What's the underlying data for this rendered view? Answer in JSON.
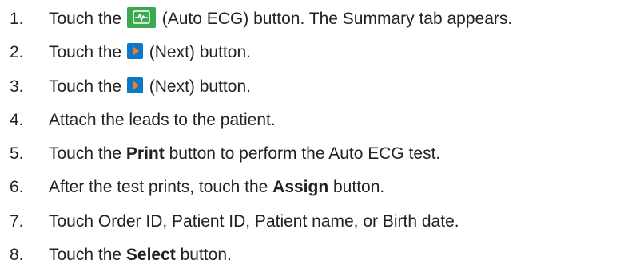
{
  "steps": [
    {
      "number": "1.",
      "parts": [
        {
          "type": "text",
          "value": "Touch the "
        },
        {
          "type": "icon",
          "icon": "auto-ecg-icon"
        },
        {
          "type": "text",
          "value": " (Auto ECG) button. The Summary tab appears."
        }
      ]
    },
    {
      "number": "2.",
      "parts": [
        {
          "type": "text",
          "value": "Touch the "
        },
        {
          "type": "icon",
          "icon": "next-icon"
        },
        {
          "type": "text",
          "value": " (Next) button."
        }
      ]
    },
    {
      "number": "3.",
      "parts": [
        {
          "type": "text",
          "value": "Touch the "
        },
        {
          "type": "icon",
          "icon": "next-icon"
        },
        {
          "type": "text",
          "value": " (Next) button."
        }
      ]
    },
    {
      "number": "4.",
      "parts": [
        {
          "type": "text",
          "value": "Attach the leads to the patient."
        }
      ]
    },
    {
      "number": "5.",
      "parts": [
        {
          "type": "text",
          "value": "Touch the "
        },
        {
          "type": "bold",
          "value": "Print"
        },
        {
          "type": "text",
          "value": " button to perform the Auto ECG test."
        }
      ]
    },
    {
      "number": "6.",
      "parts": [
        {
          "type": "text",
          "value": "After the test prints, touch the "
        },
        {
          "type": "bold",
          "value": "Assign"
        },
        {
          "type": "text",
          "value": " button."
        }
      ]
    },
    {
      "number": "7.",
      "parts": [
        {
          "type": "text",
          "value": "Touch Order ID, Patient ID, Patient name, or Birth date."
        }
      ]
    },
    {
      "number": "8.",
      "parts": [
        {
          "type": "text",
          "value": "Touch the "
        },
        {
          "type": "bold",
          "value": "Select"
        },
        {
          "type": "text",
          "value": " button."
        }
      ]
    }
  ],
  "colors": {
    "text": "#222222",
    "icon_green": "#3aa84f",
    "icon_blue": "#0b79c8",
    "icon_orange": "#f5821f"
  }
}
